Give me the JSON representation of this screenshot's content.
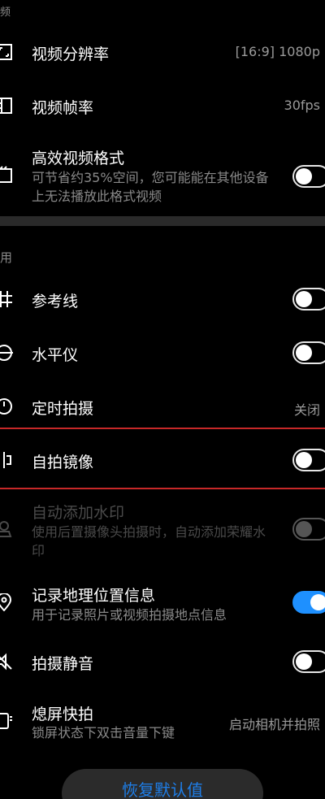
{
  "top_section_fragment": "频",
  "items_top": {
    "resolution": {
      "title": "视频分辨率",
      "value": "[16:9] 1080p"
    },
    "framerate": {
      "title": "视频帧率",
      "value": "30fps"
    },
    "hevc": {
      "title": "高效视频格式",
      "desc": "可节省约35%空间，您可能能在其他设备上无法播放此格式视频",
      "toggle": "off"
    }
  },
  "general_section": {
    "label_fragment": "用"
  },
  "items_general": {
    "grid": {
      "title": "参考线",
      "toggle": "off"
    },
    "level": {
      "title": "水平仪",
      "toggle": "off"
    },
    "timer": {
      "title": "定时拍摄",
      "value": "关闭"
    },
    "mirror": {
      "title": "自拍镜像",
      "toggle": "off"
    },
    "watermark": {
      "title": "自动添加水印",
      "desc": "使用后置摄像头拍摄时，自动添加荣耀水印",
      "toggle": "off",
      "disabled": true
    },
    "location": {
      "title": "记录地理位置信息",
      "desc": "用于记录照片或视频拍摄地点信息",
      "toggle": "on"
    },
    "mute": {
      "title": "拍摄静音",
      "toggle": "off"
    },
    "quick_snap": {
      "title": "熄屏快拍",
      "desc": "锁屏状态下双击音量下键",
      "value": "启动相机并拍照"
    }
  },
  "reset_button": {
    "label": "恢复默认值"
  },
  "colors": {
    "accent": "#1e90ff",
    "highlight_border": "#c62828"
  }
}
